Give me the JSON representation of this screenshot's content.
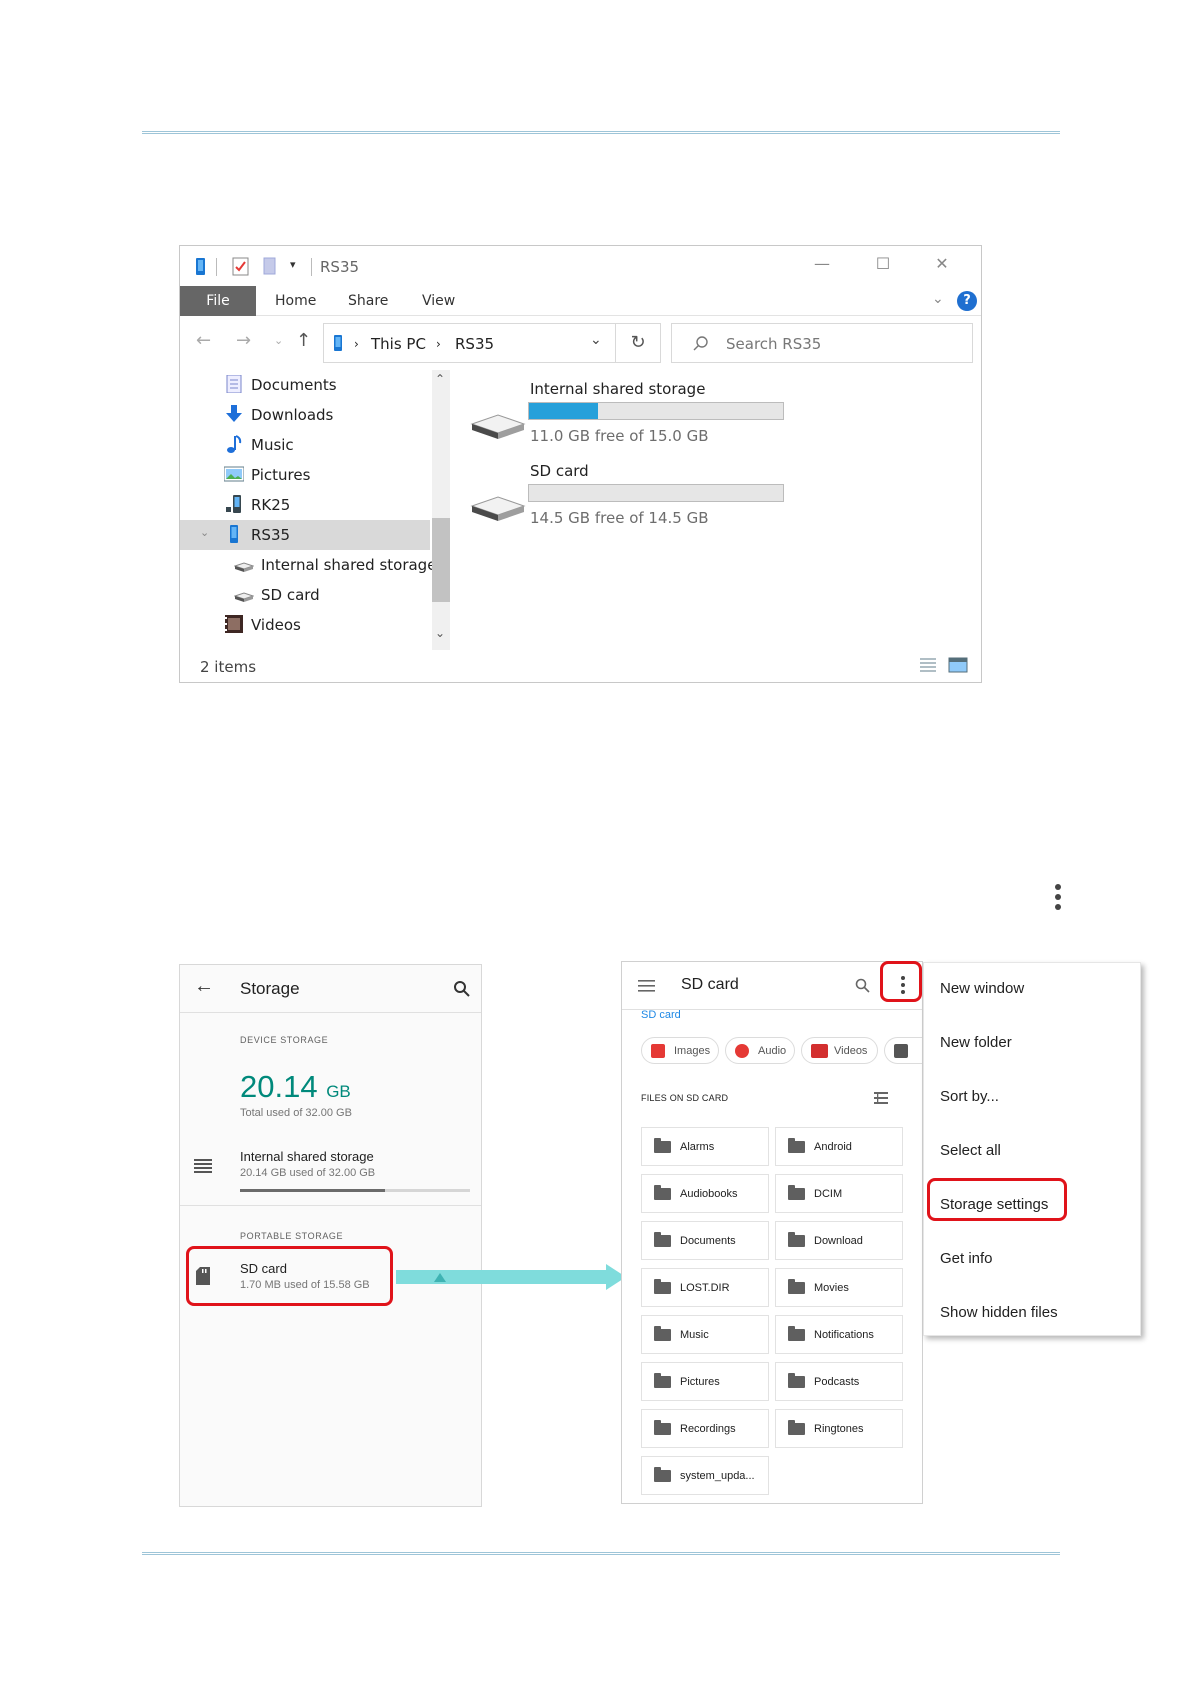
{
  "explorer": {
    "window_title": "RS35",
    "ribbon_tabs": [
      "File",
      "Home",
      "Share",
      "View"
    ],
    "help_label": "?",
    "breadcrumb": [
      "This PC",
      "RS35"
    ],
    "search_placeholder": "Search RS35",
    "tree": [
      {
        "label": "Documents",
        "icon": "documents-icon"
      },
      {
        "label": "Downloads",
        "icon": "downloads-icon"
      },
      {
        "label": "Music",
        "icon": "music-icon"
      },
      {
        "label": "Pictures",
        "icon": "pictures-icon"
      },
      {
        "label": "RK25",
        "icon": "device-icon"
      },
      {
        "label": "RS35",
        "icon": "phone-icon",
        "selected": true
      },
      {
        "label": "Internal shared storage",
        "icon": "drive-icon"
      },
      {
        "label": "SD card",
        "icon": "drive-icon"
      },
      {
        "label": "Videos",
        "icon": "videos-icon"
      }
    ],
    "drives": [
      {
        "name": "Internal shared storage",
        "free_text": "11.0 GB free of 15.0 GB",
        "used_fraction": 0.27
      },
      {
        "name": "SD card",
        "free_text": "14.5 GB free of 14.5 GB",
        "used_fraction": 0.0
      }
    ],
    "status": "2 items"
  },
  "storage_screen": {
    "title": "Storage",
    "device_section": "DEVICE STORAGE",
    "used_value": "20.14",
    "used_unit": "GB",
    "total_text": "Total used of 32.00 GB",
    "internal_title": "Internal shared storage",
    "internal_sub": "20.14 GB used of 32.00 GB",
    "internal_used_fraction": 0.63,
    "portable_section": "PORTABLE STORAGE",
    "sd_title": "SD card",
    "sd_sub": "1.70 MB used of 15.58 GB"
  },
  "sd_screen": {
    "title": "SD card",
    "crumb": "SD card",
    "chips": [
      "Images",
      "Audio",
      "Videos"
    ],
    "files_header": "FILES ON SD CARD",
    "folders": [
      "Alarms",
      "Android",
      "Audiobooks",
      "DCIM",
      "Documents",
      "Download",
      "LOST.DIR",
      "Movies",
      "Music",
      "Notifications",
      "Pictures",
      "Podcasts",
      "Recordings",
      "Ringtones",
      "system_upda..."
    ]
  },
  "overflow_menu": {
    "items": [
      "New window",
      "New folder",
      "Sort by...",
      "Select all",
      "Storage settings",
      "Get info",
      "Show hidden files"
    ]
  },
  "colors": {
    "accent_teal": "#00897b",
    "link_blue": "#1e88e5",
    "highlight_red": "#e0131a",
    "arrow_cyan": "#7fdcdc",
    "drive_bar_blue": "#26a0da"
  }
}
